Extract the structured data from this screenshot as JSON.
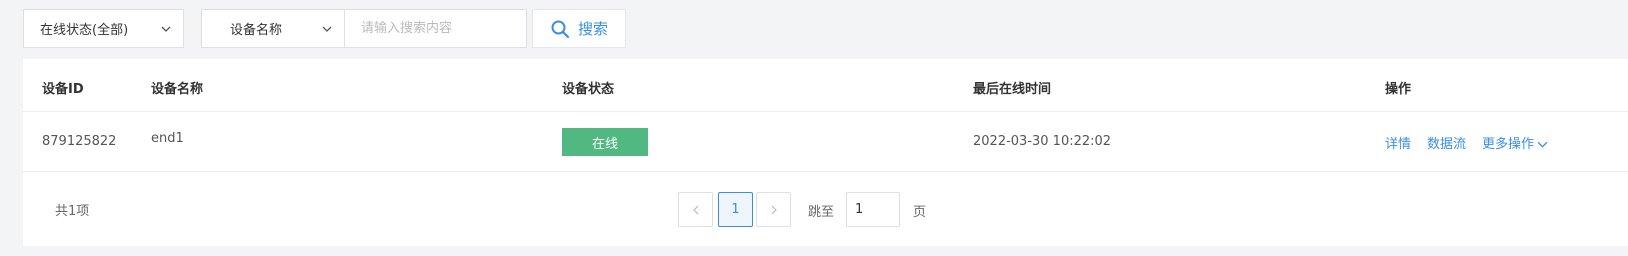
{
  "filters": {
    "status_select": {
      "value": "在线状态(全部)"
    },
    "field_select": {
      "value": "设备名称"
    },
    "search": {
      "placeholder": "请输入搜索内容",
      "value": ""
    },
    "search_button_label": "搜索"
  },
  "table": {
    "columns": [
      "设备ID",
      "设备名称",
      "设备状态",
      "最后在线时间",
      "操作"
    ],
    "rows": [
      {
        "id": "879125822",
        "name": "end1",
        "status": "在线",
        "last_online": "2022-03-30 10:22:02",
        "actions": [
          "详情",
          "数据流",
          "更多操作"
        ]
      }
    ]
  },
  "pagination": {
    "total_text": "共1项",
    "current_page": "1",
    "jump_label": "跳至",
    "jump_value": "1",
    "page_suffix": "页"
  },
  "colors": {
    "accent": "#3a8ee6",
    "status_online": "#52b882"
  },
  "icons": {
    "search": "search-icon",
    "chevron_down": "chevron-down-icon",
    "chevron_left": "chevron-left-icon",
    "chevron_right": "chevron-right-icon"
  }
}
